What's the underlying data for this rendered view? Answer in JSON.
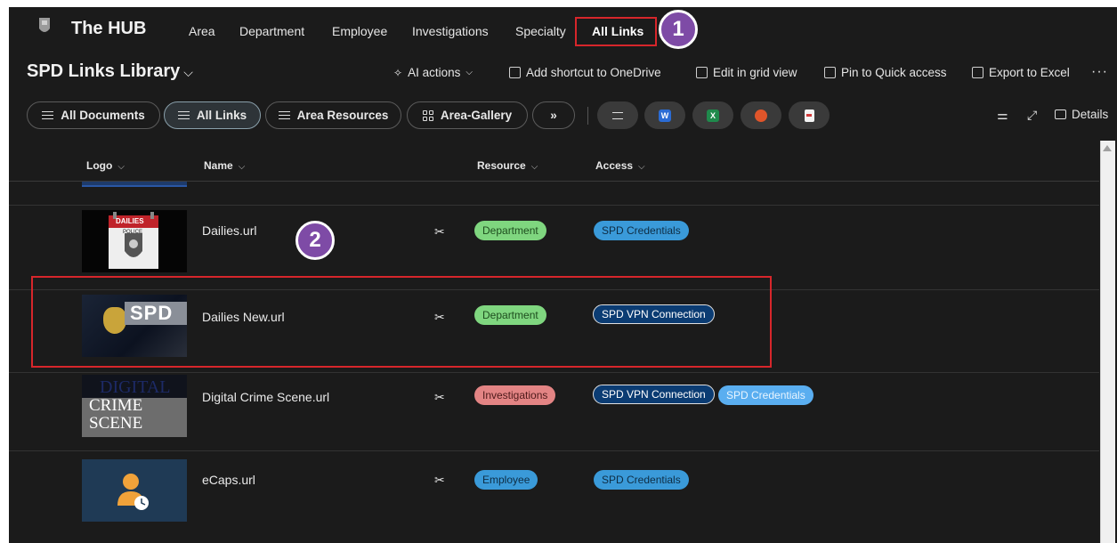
{
  "nav": {
    "site_title": "The HUB",
    "items": [
      "Area",
      "Department",
      "Employee",
      "Investigations",
      "Specialty",
      "All Links"
    ],
    "active": "All Links"
  },
  "callouts": {
    "one": "1",
    "two": "2"
  },
  "library": {
    "title": "SPD Links Library",
    "commands": {
      "ai_actions": "AI actions",
      "add_shortcut": "Add shortcut to OneDrive",
      "edit_grid": "Edit in grid view",
      "pin_quick": "Pin to Quick access",
      "export_excel": "Export to Excel",
      "more": "···"
    }
  },
  "views": {
    "all_documents": "All Documents",
    "all_links": "All Links",
    "area_resources": "Area Resources",
    "area_gallery": "Area-Gallery",
    "more": "»",
    "details": "Details"
  },
  "columns": {
    "logo": "Logo",
    "name": "Name",
    "resource": "Resource",
    "access": "Access"
  },
  "rows": [
    {
      "name": "Dailies.url",
      "resource": "Department",
      "access": [
        "SPD Credentials"
      ],
      "logo_text": "DAILIES",
      "logo_sub": "POLICE"
    },
    {
      "name": "Dailies New.url",
      "resource": "Department",
      "access": [
        "SPD VPN Connection"
      ],
      "logo_text": "SPD"
    },
    {
      "name": "Digital Crime Scene.url",
      "resource": "Investigations",
      "access": [
        "SPD VPN Connection",
        "SPD Credentials"
      ],
      "logo_text_top": "DIGITAL",
      "logo_text_mid": "CRIME",
      "logo_text_bot": "SCENE"
    },
    {
      "name": "eCaps.url",
      "resource": "Employee",
      "access": [
        "SPD Credentials"
      ]
    }
  ],
  "colors": {
    "accent_red": "#d7262b",
    "callout_purple": "#7e4ba6",
    "background": "#1b1b1b"
  }
}
